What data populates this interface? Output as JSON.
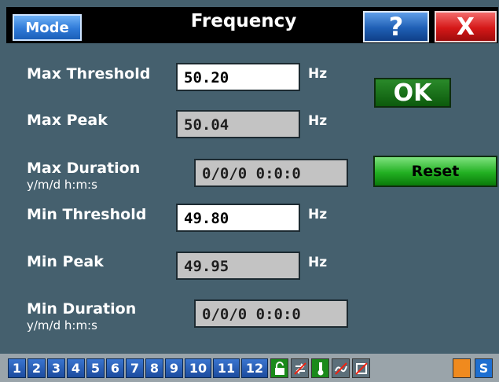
{
  "header": {
    "mode_label": "Mode",
    "title": "Frequency",
    "help_label": "?",
    "close_label": "X"
  },
  "form": {
    "max_threshold": {
      "label": "Max Threshold",
      "value": "50.20",
      "unit": "Hz"
    },
    "max_peak": {
      "label": "Max Peak",
      "value": "50.04",
      "unit": "Hz"
    },
    "max_duration": {
      "label": "Max Duration",
      "sublabel": "y/m/d  h:m:s",
      "value": "0/0/0 0:0:0"
    },
    "min_threshold": {
      "label": "Min Threshold",
      "value": "49.80",
      "unit": "Hz"
    },
    "min_peak": {
      "label": "Min Peak",
      "value": "49.95",
      "unit": "Hz"
    },
    "min_duration": {
      "label": "Min Duration",
      "sublabel": "y/m/d  h:m:s",
      "value": "0/0/0 0:0:0"
    }
  },
  "buttons": {
    "ok_label": "OK",
    "reset_label": "Reset"
  },
  "taskbar": {
    "numbers": [
      "1",
      "2",
      "3",
      "4",
      "5",
      "6",
      "7",
      "8",
      "9",
      "10",
      "11",
      "12"
    ],
    "s_label": "S"
  },
  "colors": {
    "background": "#45606e",
    "ok_green": "#0c5a0c",
    "reset_green": "#22b022",
    "help_blue": "#1f5fb4",
    "close_red": "#d51818"
  }
}
